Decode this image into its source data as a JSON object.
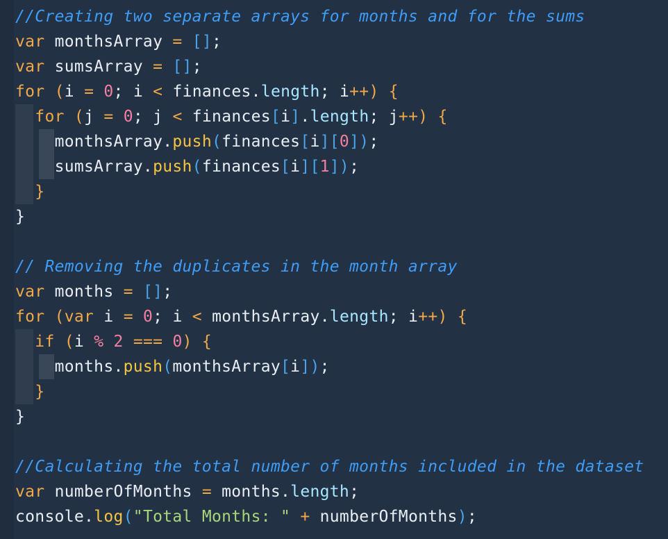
{
  "editor": {
    "comments": {
      "c1": "//Creating two separate arrays for months and for the sums",
      "c2": "// Removing the duplicates in the month array",
      "c3": "//Calculating the total number of months included in the dataset"
    },
    "tokens": {
      "var": "var",
      "for": "for",
      "if": "if",
      "monthsArray": "monthsArray",
      "sumsArray": "sumsArray",
      "months": "months",
      "numberOfMonths": "numberOfMonths",
      "finances": "finances",
      "console": "console",
      "length": "length",
      "push": "push",
      "log": "log",
      "i": "i",
      "j": "j",
      "zero": "0",
      "one": "1",
      "two": "2",
      "string": "\"Total Months: \""
    }
  }
}
